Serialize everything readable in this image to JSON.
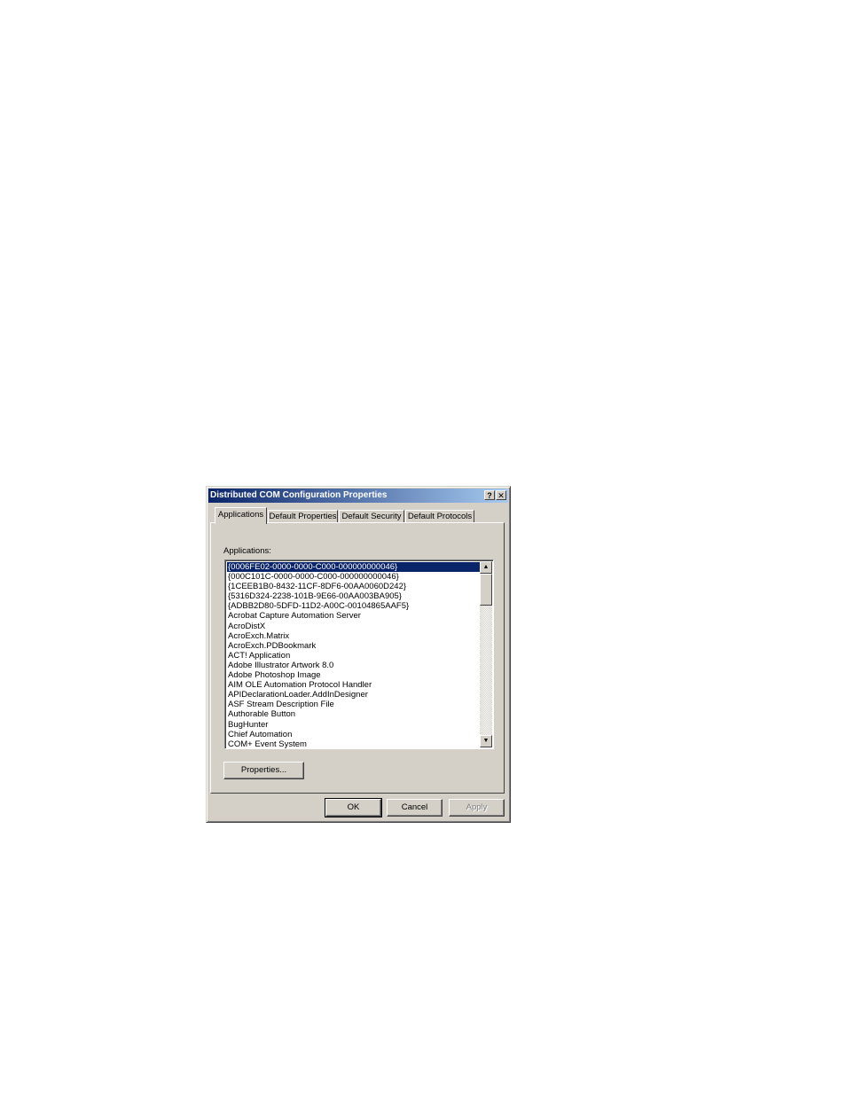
{
  "window": {
    "title": "Distributed COM Configuration Properties",
    "help_glyph": "?",
    "close_glyph": "✕"
  },
  "tabs": [
    {
      "label": "Applications",
      "active": true
    },
    {
      "label": "Default Properties",
      "active": false
    },
    {
      "label": "Default Security",
      "active": false
    },
    {
      "label": "Default Protocols",
      "active": false
    }
  ],
  "applications": {
    "label": "Applications:",
    "items": [
      "{0006FE02-0000-0000-C000-000000000046}",
      "{000C101C-0000-0000-C000-000000000046}",
      "{1CEEB1B0-8432-11CF-8DF6-00AA0060D242}",
      "{5316D324-2238-101B-9E66-00AA003BA905}",
      "{ADBB2D80-5DFD-11D2-A00C-00104865AAF5}",
      "Acrobat Capture Automation Server",
      "AcroDistX",
      "AcroExch.Matrix",
      "AcroExch.PDBookmark",
      "ACT! Application",
      "Adobe Illustrator Artwork 8.0",
      "Adobe Photoshop Image",
      "AIM OLE Automation Protocol Handler",
      "APIDeclarationLoader.AddInDesigner",
      "ASF Stream Description File",
      "Authorable Button",
      "BugHunter",
      "Chief Automation",
      "COM+ Event System"
    ],
    "selected_index": 0,
    "scroll_up_glyph": "▲",
    "scroll_down_glyph": "▼",
    "properties_button": "Properties..."
  },
  "buttons": {
    "ok": "OK",
    "cancel": "Cancel",
    "apply": "Apply"
  }
}
